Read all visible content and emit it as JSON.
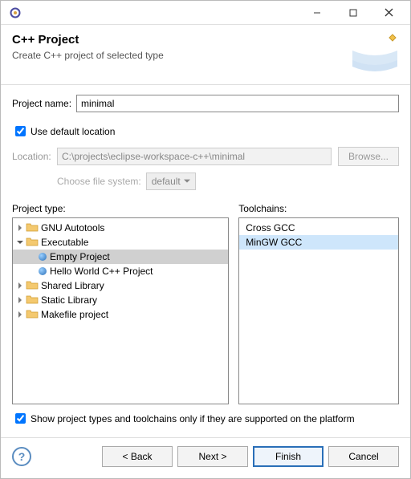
{
  "titlebar": {
    "title": ""
  },
  "header": {
    "title": "C++ Project",
    "subtitle": "Create C++ project of selected type"
  },
  "fields": {
    "projectNameLabel": "Project name:",
    "projectNameValue": "minimal",
    "useDefaultLocationLabel": "Use default location",
    "useDefaultLocationChecked": true,
    "locationLabel": "Location:",
    "locationValue": "C:\\projects\\eclipse-workspace-c++\\minimal",
    "browseLabel": "Browse...",
    "fileSystemLabel": "Choose file system:",
    "fileSystemValue": "default"
  },
  "projectTypeLabel": "Project type:",
  "toolchainsLabel": "Toolchains:",
  "projectTypes": [
    {
      "label": "GNU Autotools",
      "expanded": false,
      "icon": "folder"
    },
    {
      "label": "Executable",
      "expanded": true,
      "icon": "folder",
      "children": [
        {
          "label": "Empty Project",
          "selected": true
        },
        {
          "label": "Hello World C++ Project",
          "selected": false
        }
      ]
    },
    {
      "label": "Shared Library",
      "expanded": false,
      "icon": "folder"
    },
    {
      "label": "Static Library",
      "expanded": false,
      "icon": "folder"
    },
    {
      "label": "Makefile project",
      "expanded": false,
      "icon": "folder"
    }
  ],
  "toolchains": [
    {
      "label": "Cross GCC",
      "selected": false
    },
    {
      "label": "MinGW GCC",
      "selected": true
    }
  ],
  "showSupported": {
    "label": "Show project types and toolchains only if they are supported on the platform",
    "checked": true
  },
  "buttons": {
    "back": "< Back",
    "next": "Next >",
    "finish": "Finish",
    "cancel": "Cancel"
  }
}
